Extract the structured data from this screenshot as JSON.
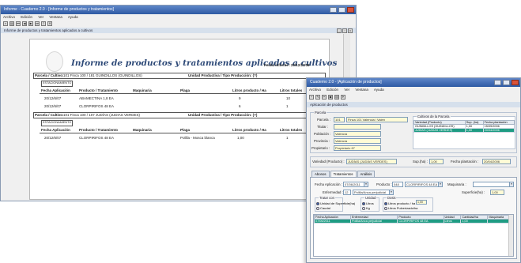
{
  "back": {
    "title": "Informe - Cuaderno 2.0 - [Informe de productos y tratamientos]",
    "menu": [
      "Archivo",
      "Edición",
      "Ver",
      "Ventana",
      "Ayuda"
    ],
    "toolbar_icons": [
      "zoom-icon",
      "print-icon",
      "first-page-icon",
      "prev-page-icon",
      "next-page-icon",
      "last-page-icon",
      "export-icon",
      "close-icon"
    ],
    "strip_text": "Informe de productos y tratamientos aplicados a cultivos",
    "report": {
      "title": "Informe de productos y tratamientos aplicados a cultivos",
      "date_label": "Fecha informe :",
      "date_value": "20/12/11/06",
      "columns": [
        "Fecha Aplicación",
        "Producto / Tratamiento",
        "Maquinaria",
        "Plaga",
        "Litros producto / Ha",
        "Litros totales"
      ],
      "sections": [
        {
          "parcela_label": "Parcela / Cultivo:",
          "parcela_value": "101 Finca 100 / 181 GUINDILLOS (GUINDILLOS)",
          "unidad_label": "Unidad Productiva / Tipo Producción: (?)",
          "code": "ESTACIONAMIENTO",
          "rows": [
            {
              "fecha": "20/12/6/07",
              "producto": "ABAMECTINA 1,8 EA",
              "maquinaria": "",
              "plaga": "",
              "litros_ha": "9",
              "litros_tot": "10"
            },
            {
              "fecha": "20/12/6/07",
              "producto": "CLORPIRIFOS 48 EA",
              "maquinaria": "",
              "plaga": "",
              "litros_ha": "6",
              "litros_tot": "1"
            }
          ]
        },
        {
          "parcela_label": "Parcela / Cultivo:",
          "parcela_value": "101 Finca 100 / 107 JUDÍAS (JUDIAS VERDES)",
          "unidad_label": "Unidad Productiva / Tipo Producción: (?)",
          "code": "ESTACIONAMIENTO",
          "rows": [
            {
              "fecha": "20/12/6/07",
              "producto": "CLORPIRIFOS 48 EA",
              "maquinaria": "",
              "plaga": "Polilla - Mosca blanca",
              "litros_ha": "1,00",
              "litros_tot": "1"
            }
          ]
        }
      ]
    }
  },
  "front": {
    "title": "Cuaderno 2.0 - [Aplicación de productos]",
    "menu": [
      "Archivo",
      "Edición",
      "Ver",
      "Ventana",
      "Ayuda"
    ],
    "strip_text": "Aplicación de productos",
    "parcela_group": "Parcela",
    "fields": {
      "parcela_label": "Parcela :",
      "parcela_code": "101",
      "parcela_value": "Finca 101 Valencia / Valen",
      "titular_label": "Titular :",
      "titular_value": "",
      "poblacion_label": "Población :",
      "poblacion_value": "Valencia",
      "provincia_label": "Provincia :",
      "provincia_value": "Valencia",
      "propietario_label": "Propietario :",
      "propietario_value": "Propietario 67"
    },
    "cultivos": {
      "group": "Cultivos de la Parcela",
      "columns": [
        "Variedad (Producto)",
        "Sup. (ha)",
        "Fecha plantación"
      ],
      "rows": [
        {
          "v": "GUINDILLOS (GUINDILLOS)",
          "s": "1,00",
          "f": "15/09/2006"
        },
        {
          "v": "JUDÍAS (JUDÍAS VERDES)",
          "s": "1,00",
          "f": "20/04/2006"
        }
      ],
      "selected_row": 1
    },
    "variedad": {
      "label": "Variedad (Producto) :",
      "value": "JUDÍAS (JUDÍAS VERDES)",
      "sup_label": "Sup.(ha) :",
      "sup_value": "1,00",
      "fecha_label": "Fecha plantación :",
      "fecha_value": "20/04/2006"
    },
    "tabs": [
      "Abonos",
      "Tratamientos",
      "Análisis"
    ],
    "active_tab": 1,
    "trat": {
      "fecha_label": "Fecha Aplicación :",
      "fecha_value": "07/06/2011",
      "producto_label": "Producto :",
      "producto_code": "048",
      "producto_value": "CLORPIRIFOS 48 EA",
      "maquinaria_label": "Maquinaria :",
      "maquinaria_value": "",
      "enfermedad_label": "Enfermedad :",
      "enfermedad_code": "12",
      "enfermedad_value": "Polilla/Anca perjudicial",
      "superficie_label": "Superficie(ha) :",
      "superficie_value": "1,00",
      "tratar_label": "Tratar con",
      "opt1": "Unidad de Superficie(ha)",
      "opt2": "Caudal",
      "unidad_label": "Unidad",
      "unit1": "Litros",
      "unit2": "Kg",
      "dosis_label": "Dosis",
      "dosis1": "Litros producto / ha",
      "dosis1_value": "1,00",
      "dosis2": "Litros Pulverizado/ha"
    },
    "grid": {
      "columns": [
        "Fecha Aplicación",
        "Enfermedad",
        "Producto",
        "Unidad",
        "Cantidad/ha",
        "Maquinaria"
      ],
      "row": [
        "07/06/2011",
        "Polilla/Anca perjudicial",
        "CLORPIRIFOS 48 EA",
        "Litros",
        "1,00",
        ""
      ]
    }
  }
}
